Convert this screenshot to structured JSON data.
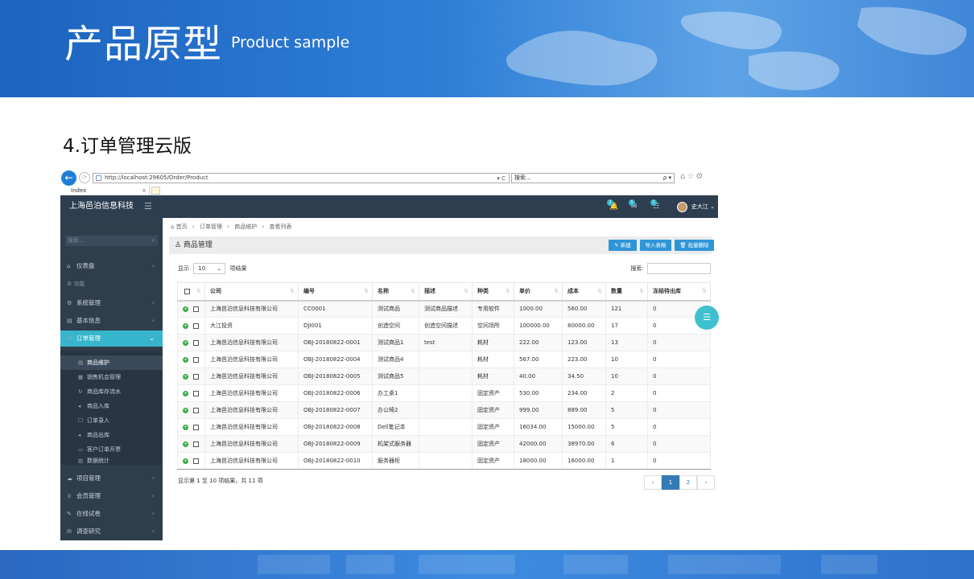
{
  "slide": {
    "title": "产品原型",
    "subtitle": "Product sample",
    "section": "4.订单管理云版"
  },
  "browser": {
    "url": "http://localhost:29605/Order/Product",
    "url_tools": "▾ C",
    "search_placeholder": "搜索...",
    "search_tools": "ρ ▾",
    "back_icon": "←",
    "forward_icon": "⟳",
    "right_icons": "⌂☆⚙",
    "tab_label": "Index",
    "tab_close": "×"
  },
  "app": {
    "brand": "上海邑泊信息科技",
    "menu_toggle": "☰",
    "notifications": [
      {
        "count": "2",
        "icon": "bell-icon",
        "glyph": "🔔"
      },
      {
        "count": "1",
        "icon": "mail-icon",
        "glyph": "✉"
      },
      {
        "count": "1",
        "icon": "list-icon",
        "glyph": "☷"
      }
    ],
    "user": "史大江",
    "user_chevron": "⌄",
    "side_search_placeholder": "搜索...",
    "side_search_icon": "⌕",
    "sidebar": [
      {
        "label": "仪表盘",
        "icon": "⌂",
        "chev": "‹"
      },
      {
        "label": "功能",
        "icon": "⚙",
        "section": true
      },
      {
        "label": "系统管理",
        "icon": "⚙",
        "chev": "‹"
      },
      {
        "label": "基本信息",
        "icon": "▤",
        "chev": "‹"
      },
      {
        "label": "订单管理",
        "icon": "🛒",
        "chev": "⌄",
        "active": true
      },
      {
        "label": "项目管理",
        "icon": "☁",
        "chev": "‹"
      },
      {
        "label": "会员管理",
        "icon": "♕",
        "chev": "‹"
      },
      {
        "label": "在线试卷",
        "icon": "✎",
        "chev": "‹"
      },
      {
        "label": "调查研究",
        "icon": "✉",
        "chev": "‹"
      }
    ],
    "submenu": [
      {
        "label": "商品维护",
        "icon": "▤",
        "current": true
      },
      {
        "label": "销售机会管理",
        "icon": "▦"
      },
      {
        "label": "商品库存流水",
        "icon": "↻"
      },
      {
        "label": "商品入库",
        "icon": "◂"
      },
      {
        "label": "订单录入",
        "icon": "☐"
      },
      {
        "label": "商品出库",
        "icon": "◂"
      },
      {
        "label": "客户订单开票",
        "icon": "▭"
      },
      {
        "label": "数据统计",
        "icon": "▥"
      }
    ],
    "breadcrumb": [
      "⌂ 首页",
      "›",
      "订单管理",
      "›",
      "商品维护",
      "›",
      "查看列表"
    ],
    "panel_title": "♙ 商品管理",
    "buttons": {
      "new": "✎ 新建",
      "import": "导入表格",
      "batch_delete": "🗑 批量删除"
    },
    "length": {
      "prefix": "显示",
      "value": "10",
      "arrow": "⌄",
      "suffix": "项结果"
    },
    "filter_label": "搜索:",
    "columns": [
      "公司",
      "编号",
      "名称",
      "描述",
      "种类",
      "单价",
      "成本",
      "数量",
      "冻结待出库"
    ],
    "sort_glyph": "⇅",
    "rows": [
      [
        "上海邑泊信息科技有限公司",
        "CC0001",
        "测试商品",
        "测试商品描述",
        "专用软件",
        "1000.00",
        "560.00",
        "121",
        "0"
      ],
      [
        "大江投资",
        "DJI001",
        "创造空间",
        "创造空间描述",
        "空间场所",
        "100000.00",
        "80000.00",
        "17",
        "0"
      ],
      [
        "上海邑泊信息科技有限公司",
        "OBJ-20180822-0001",
        "测试商品1",
        "test",
        "耗材",
        "222.00",
        "123.00",
        "13",
        "0"
      ],
      [
        "上海邑泊信息科技有限公司",
        "OBJ-20180822-0004",
        "测试商品4",
        "",
        "耗材",
        "567.00",
        "223.00",
        "10",
        "0"
      ],
      [
        "上海邑泊信息科技有限公司",
        "OBJ-20180822-0005",
        "测试商品5",
        "",
        "耗材",
        "40.00",
        "34.50",
        "10",
        "0"
      ],
      [
        "上海邑泊信息科技有限公司",
        "OBJ-20180822-0006",
        "办工桌1",
        "",
        "固定资产",
        "530.00",
        "234.00",
        "2",
        "0"
      ],
      [
        "上海邑泊信息科技有限公司",
        "OBJ-20180822-0007",
        "办公椅2",
        "",
        "固定资产",
        "999.00",
        "889.00",
        "5",
        "0"
      ],
      [
        "上海邑泊信息科技有限公司",
        "OBJ-20180822-0008",
        "Dell笔记本",
        "",
        "固定资产",
        "16034.00",
        "15000.00",
        "5",
        "0"
      ],
      [
        "上海邑泊信息科技有限公司",
        "OBJ-20180822-0009",
        "机架式服务器",
        "",
        "固定资产",
        "42000.00",
        "38970.00",
        "6",
        "0"
      ],
      [
        "上海邑泊信息科技有限公司",
        "OBJ-20180822-0010",
        "服务器柜",
        "",
        "固定资产",
        "18000.00",
        "16000.00",
        "1",
        "0"
      ]
    ],
    "info": "显示第 1 至 10 项结果，共 11 项",
    "pager": [
      "‹",
      "1",
      "2",
      "›"
    ],
    "float_icon": "☰"
  },
  "colors": {
    "accent": "#36b5cc",
    "topbar": "#2d3e50",
    "sidebar": "#2f3e4d",
    "button": "#2f96d6"
  }
}
